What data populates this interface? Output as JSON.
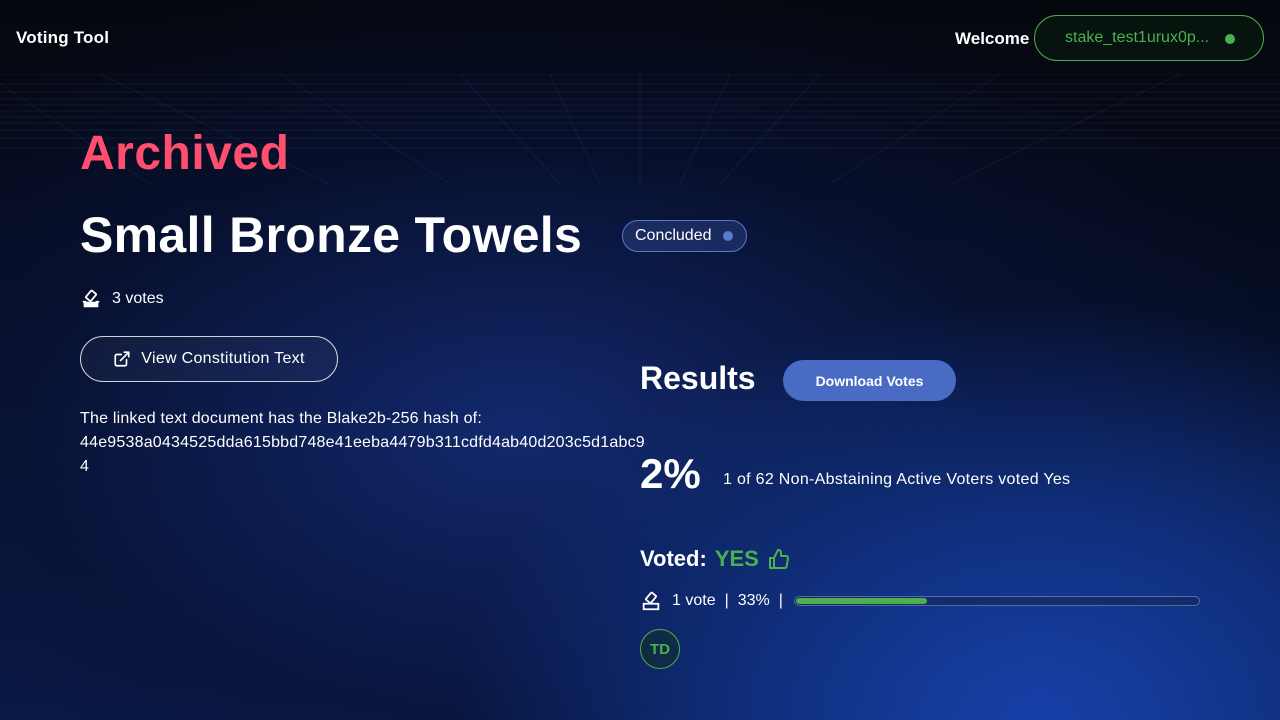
{
  "header": {
    "app_title": "Voting Tool",
    "welcome_label": "Welcome",
    "wallet_address": "stake_test1urux0p...",
    "wallet_status_color": "#4caf50"
  },
  "proposal": {
    "archive_status": "Archived",
    "title": "Small Bronze Towels",
    "status_badge": "Concluded",
    "votes_count_label": "3 votes",
    "view_constitution_label": "View Constitution Text",
    "hash_intro": "The linked text document has the Blake2b-256 hash of:",
    "hash_value": "44e9538a0434525dda615bbd748e41eeba4479b311cdfd4ab40d203c5d1abc94"
  },
  "results": {
    "title": "Results",
    "download_label": "Download Votes",
    "yes_percent": "2%",
    "summary": "1 of 62 Non-Abstaining Active Voters voted Yes",
    "voted_label": "Voted:",
    "voted_choice": "YES",
    "choice_votes": "1 vote",
    "choice_percent": "33%",
    "choice_fraction": 0.33,
    "voter_initials": "TD"
  },
  "colors": {
    "archived": "#ff4f6e",
    "yes": "#4caf50",
    "accent": "#4a6bc4"
  },
  "icons": [
    "ballot-icon",
    "external-link-icon",
    "thumbs-up-icon",
    "status-dot-icon"
  ]
}
